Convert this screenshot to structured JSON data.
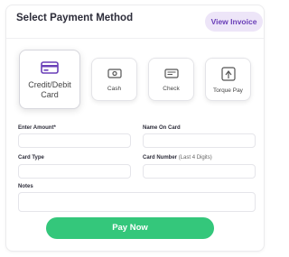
{
  "header": {
    "title": "Select Payment Method",
    "view_invoice": "View Invoice"
  },
  "methods": [
    {
      "label": "Credit/Debit Card",
      "icon": "credit-card-icon",
      "selected": true
    },
    {
      "label": "Cash",
      "icon": "cash-icon",
      "selected": false
    },
    {
      "label": "Check",
      "icon": "check-icon",
      "selected": false
    },
    {
      "label": "Torque Pay",
      "icon": "torque-pay-icon",
      "selected": false
    }
  ],
  "form": {
    "amount_label": "Enter Amount*",
    "name_label": "Name On Card",
    "card_type_label": "Card Type",
    "card_number_label": "Card Number",
    "card_number_hint": "(Last 4 Digits)",
    "notes_label": "Notes"
  },
  "pay_button": "Pay Now",
  "colors": {
    "accent": "#6a3fb8",
    "accent_bg": "#ede5f8",
    "pay_green": "#34c77b"
  }
}
